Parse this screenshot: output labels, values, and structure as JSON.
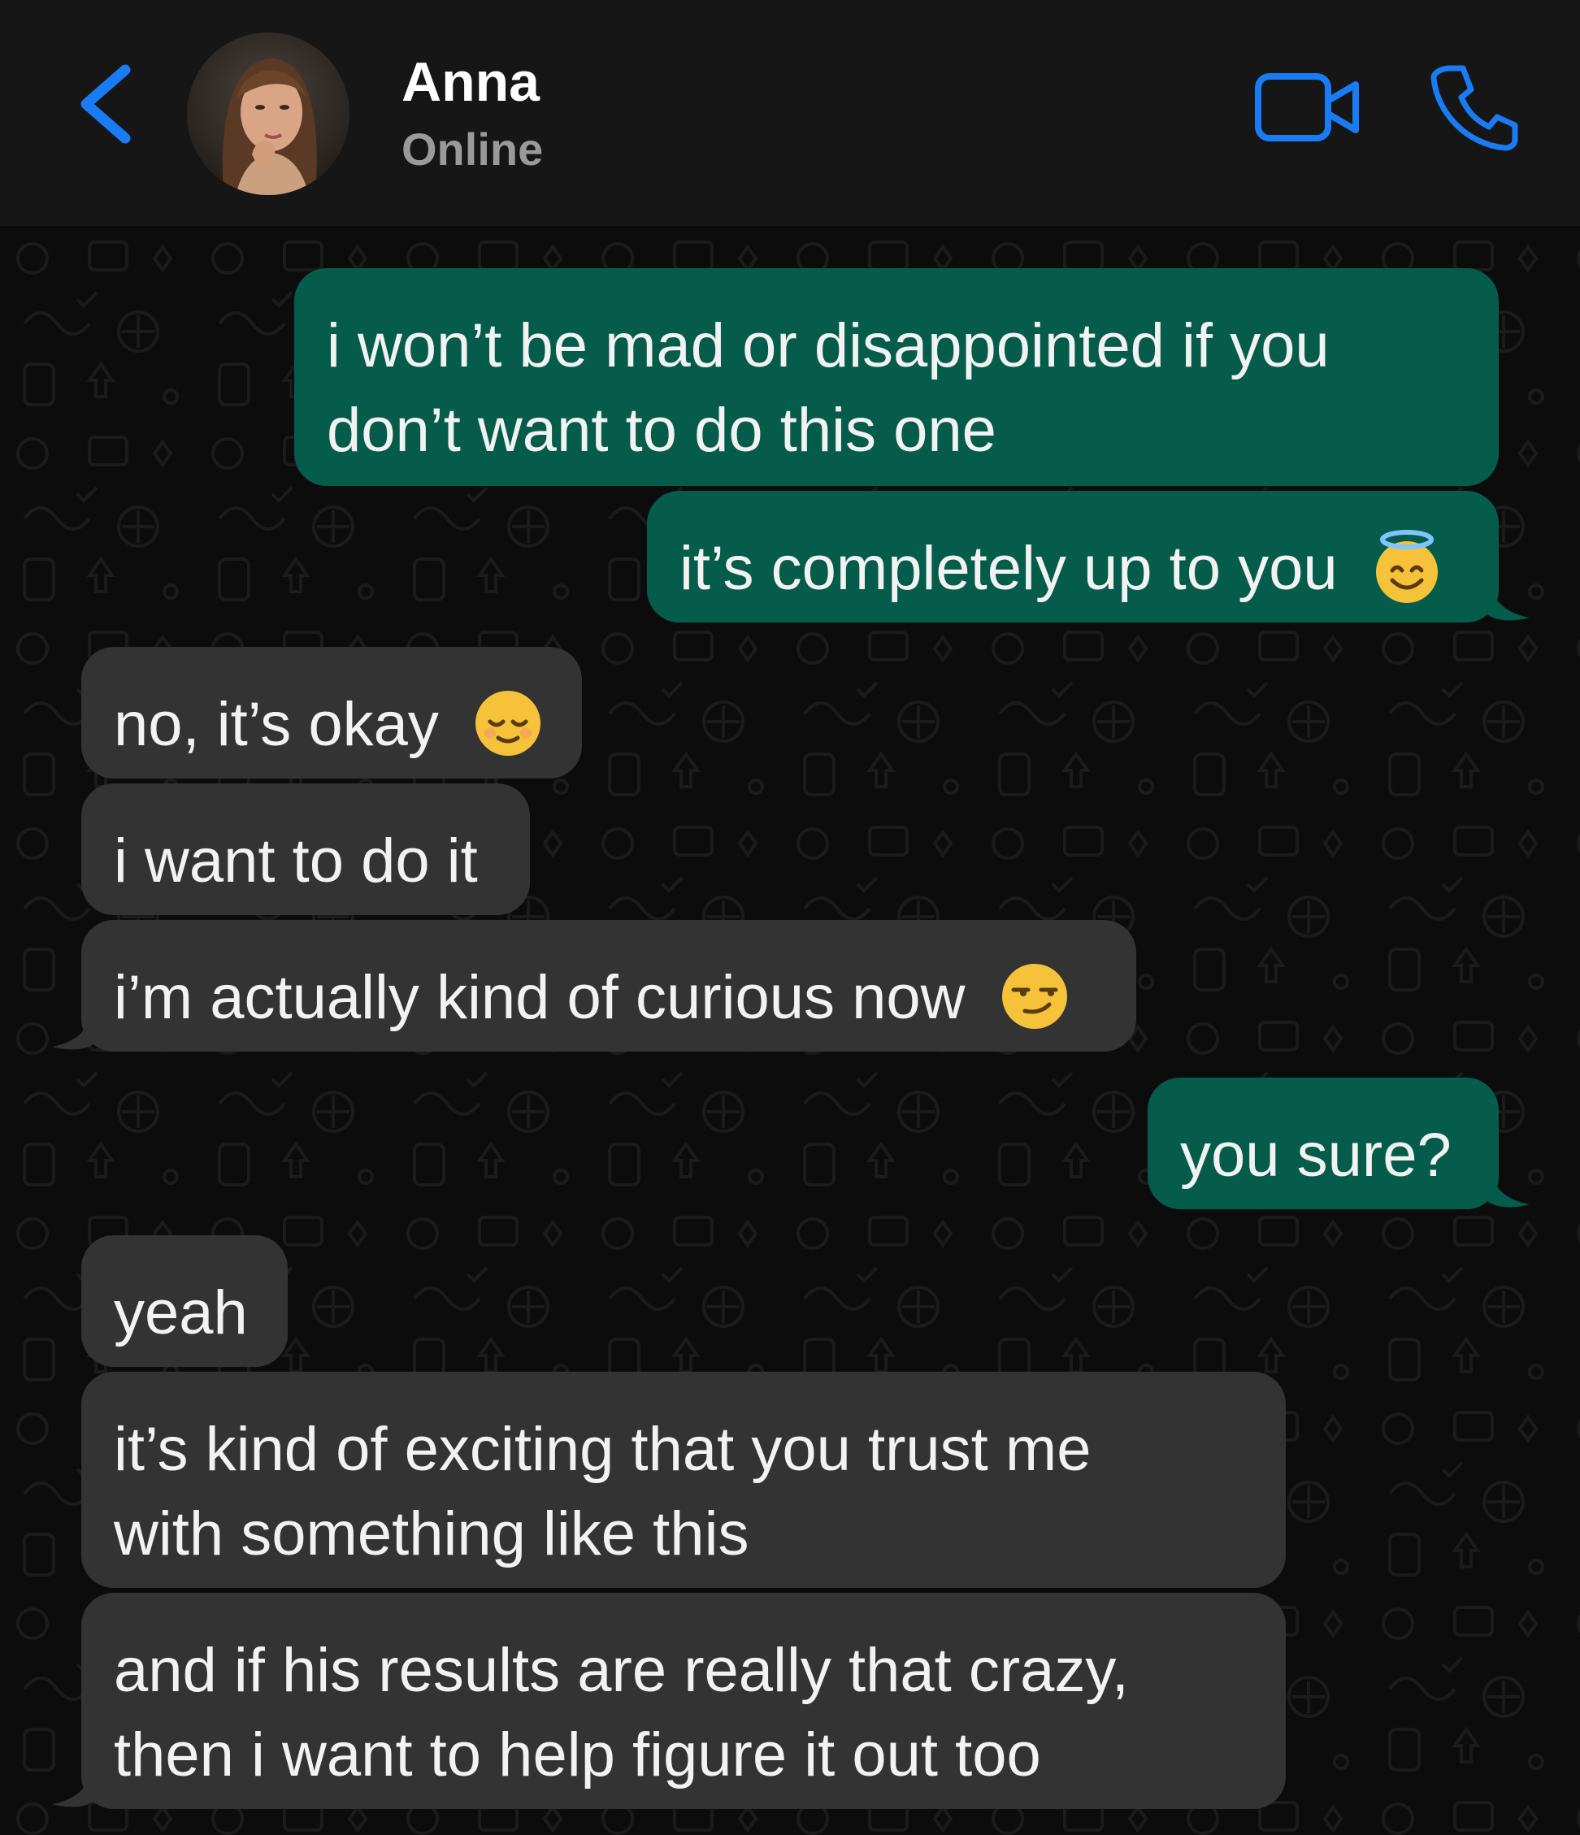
{
  "contact": {
    "name": "Anna",
    "status": "Online"
  },
  "icons": {
    "back": "chevron-left-icon",
    "video": "video-camera-icon",
    "call": "phone-icon",
    "accent": "#1a7cf5"
  },
  "colors": {
    "outgoing_bubble": "#055c4b",
    "incoming_bubble": "#333333",
    "header_bg": "#161616",
    "chat_bg": "#0c0c0c"
  },
  "messages": [
    {
      "direction": "out",
      "lines": [
        "i won’t be mad or disappointed if you",
        "don’t want to do this one"
      ]
    },
    {
      "direction": "out",
      "lines": [
        "it’s completely up to you"
      ],
      "emoji": "smiling-face-with-halo"
    },
    {
      "direction": "in",
      "lines": [
        "no, it’s okay"
      ],
      "emoji": "relieved-face"
    },
    {
      "direction": "in",
      "lines": [
        "i want to do it"
      ]
    },
    {
      "direction": "in",
      "lines": [
        "i’m actually kind of curious now"
      ],
      "emoji": "smirking-face"
    },
    {
      "direction": "out",
      "lines": [
        "you sure?"
      ]
    },
    {
      "direction": "in",
      "lines": [
        "yeah"
      ]
    },
    {
      "direction": "in",
      "lines": [
        "it’s kind of exciting that you trust me",
        "with something like this"
      ]
    },
    {
      "direction": "in",
      "lines": [
        "and if his results are really that crazy,",
        "then i want to help figure it out too"
      ]
    }
  ]
}
